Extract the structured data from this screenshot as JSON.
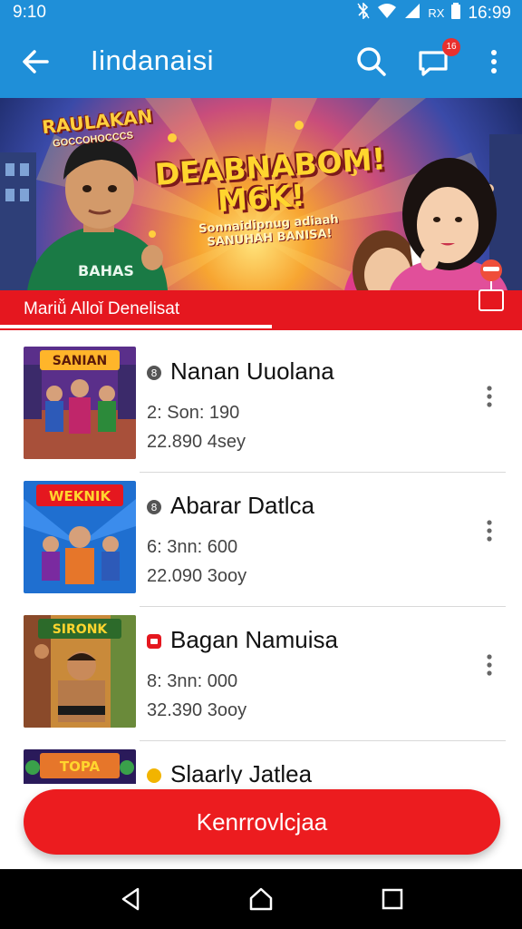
{
  "status_bar": {
    "time": "9:10",
    "carrier": "RX",
    "right_time": "16:99",
    "icons": [
      "bluetooth-off-icon",
      "wifi-icon",
      "signal-icon",
      "battery-icon"
    ]
  },
  "app_bar": {
    "title": "Iindanaisi",
    "chat_badge": "16",
    "icons": [
      "back-arrow-icon",
      "search-icon",
      "chat-icon",
      "more-vert-icon"
    ]
  },
  "banner": {
    "logo_title": "RAULAKAN",
    "logo_subtitle": "GOCCOHOCCCS",
    "headline_line1": "DEABNABOM!",
    "headline_line2": "M6K!",
    "subline_line1": "Sonnaidipnug adiaah",
    "subline_line2": "SANUHAH BANISA!"
  },
  "promo": {
    "label": "Mariǚ Alloǐ Denelisat"
  },
  "games": [
    {
      "name": "Nanan Uuolana",
      "stat1": "2: Son: 190",
      "stat2": "22.890 4sey",
      "thumb_title": "SANIAN",
      "badge_color": "#555555"
    },
    {
      "name": "Abarar Datlca",
      "stat1": "6: 3nn: 600",
      "stat2": "22.090 3ooy",
      "thumb_title": "WEKNIK",
      "badge_color": "#555555"
    },
    {
      "name": "Bagan Namuisa",
      "stat1": "8: 3nn: 000",
      "stat2": "32.390 3ooy",
      "thumb_title": "SIRONK",
      "badge_color": "#e5171f"
    },
    {
      "name": "Slaarly Jatlea",
      "stat1": "",
      "stat2": "",
      "thumb_title": "TOPA",
      "badge_color": "#f2b400"
    }
  ],
  "cta": {
    "label": "Kenrrovlcjaa"
  },
  "colors": {
    "primary_blue": "#1f8fd8",
    "accent_red": "#e5171f",
    "cta_red": "#ec1c1f"
  },
  "nav_bar": {
    "icons": [
      "nav-back-icon",
      "nav-home-icon",
      "nav-recents-icon"
    ]
  }
}
